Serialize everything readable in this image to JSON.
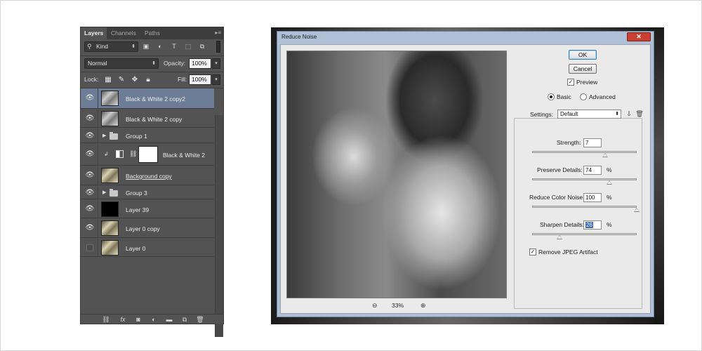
{
  "layers_panel": {
    "tabs": [
      "Layers",
      "Channels",
      "Paths"
    ],
    "filter_kind": "Kind",
    "blend_mode": "Normal",
    "opacity_label": "Opacity:",
    "opacity_value": "100%",
    "lock_label": "Lock:",
    "fill_label": "Fill:",
    "fill_value": "100%",
    "layers": [
      {
        "name": "Black & White 2 copy2",
        "selected": true,
        "visible": true
      },
      {
        "name": "Black & White 2 copy",
        "selected": false,
        "visible": true
      },
      {
        "name": "Group 1",
        "type": "group",
        "visible": true
      },
      {
        "name": "Black & White 2",
        "type": "adjustment",
        "visible": true
      },
      {
        "name": "Background  copy",
        "visible": true
      },
      {
        "name": "Group 3",
        "type": "group",
        "visible": true
      },
      {
        "name": "Layer 39",
        "visible": true
      },
      {
        "name": "Layer 0 copy",
        "visible": true
      },
      {
        "name": "Layer 0",
        "visible": false
      }
    ]
  },
  "dialog": {
    "title": "Reduce Noise",
    "close_symbol": "✕",
    "ok_label": "OK",
    "cancel_label": "Cancel",
    "preview_label": "Preview",
    "preview_checked": true,
    "mode_basic": "Basic",
    "mode_advanced": "Advanced",
    "mode_selected": "Basic",
    "settings_label": "Settings:",
    "settings_value": "Default",
    "zoom_value": "33%",
    "strength_label": "Strength:",
    "strength_value": "7",
    "strength_level": 0.7,
    "preserve_label": "Preserve Details:",
    "preserve_value": "74",
    "preserve_level": 0.74,
    "color_noise_label": "Reduce Color Noise:",
    "color_noise_value": "100",
    "color_noise_level": 1.0,
    "sharpen_label": "Sharpen Details:",
    "sharpen_value": "26",
    "sharpen_level": 0.26,
    "percent": "%",
    "jpeg_label": "Remove JPEG Artifact",
    "jpeg_checked": true
  }
}
